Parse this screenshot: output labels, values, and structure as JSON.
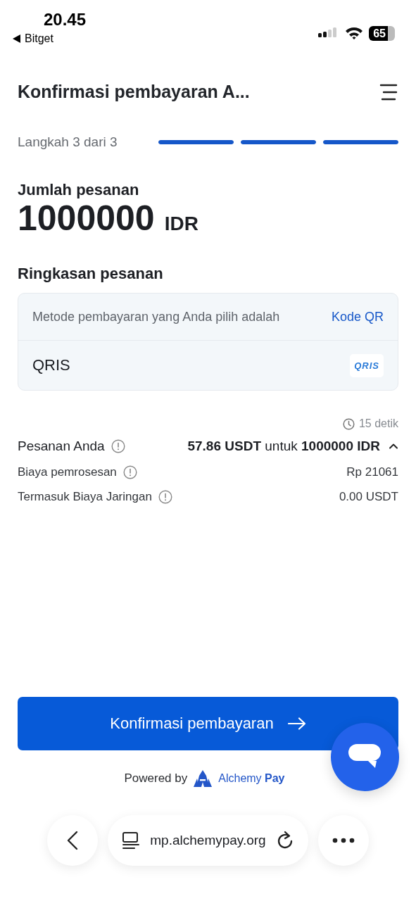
{
  "status_bar": {
    "time": "20.45",
    "back_app": "Bitget",
    "battery": "65"
  },
  "header": {
    "title": "Konfirmasi pembayaran A..."
  },
  "progress": {
    "label": "Langkah 3 dari 3",
    "steps": [
      {
        "level": 1
      },
      {
        "level": 1
      },
      {
        "level": 1
      }
    ]
  },
  "amount": {
    "label": "Jumlah pesanan",
    "value": "1000000",
    "currency": "IDR"
  },
  "summary": {
    "title": "Ringkasan pesanan",
    "method_label": "Metode pembayaran yang Anda pilih adalah",
    "method_value": "Kode QR",
    "method_name": "QRIS",
    "logo_text": "QRIS"
  },
  "quote": {
    "timer": "15 detik",
    "label": "Pesanan Anda",
    "value": "**57.86 USDT** untuk **1000000 IDR**",
    "expanded": true
  },
  "fees": [
    {
      "label": "Biaya pemrosesan",
      "value": "Rp 21061"
    },
    {
      "label": "Termasuk Biaya Jaringan",
      "value": "0.00 USDT"
    }
  ],
  "confirm_button": "Konfirmasi pembayaran",
  "powered": {
    "label": "Powered by",
    "brand": "Alchemy **Pay**"
  },
  "browser_bar": {
    "url": "mp.alchemypay.org"
  }
}
